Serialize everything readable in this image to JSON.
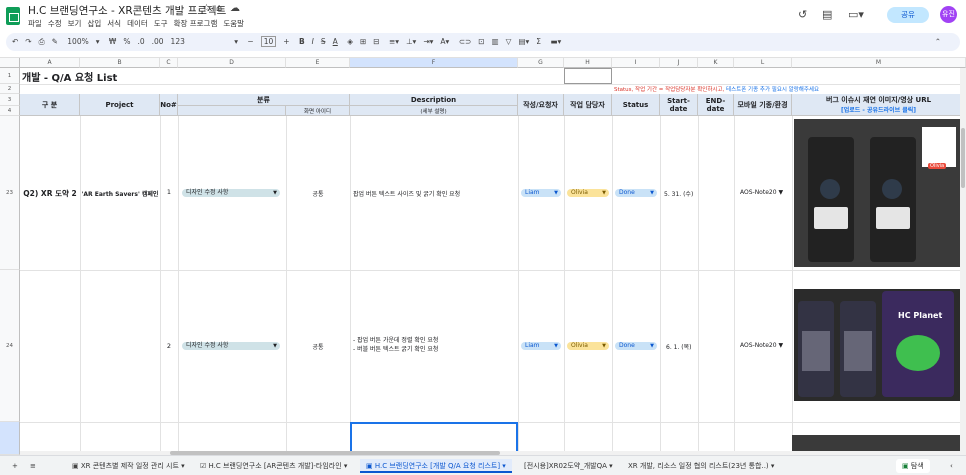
{
  "doc": {
    "title": "H.C 브랜딩연구소 - XR콘텐츠 개발 프로젝트",
    "user_initial": "유진",
    "share_label": "공유"
  },
  "menu": [
    "파일",
    "수정",
    "보기",
    "삽입",
    "서식",
    "데이터",
    "도구",
    "확장 프로그램",
    "도움말"
  ],
  "toolbar": {
    "zoom": "100%",
    "currency": "₩",
    "percent": "%",
    "dec_less": ".0",
    "dec_more": ".00",
    "number_format": "123",
    "font_size": "10"
  },
  "columns": [
    "A",
    "B",
    "C",
    "D",
    "E",
    "F",
    "G",
    "H",
    "I",
    "J",
    "K",
    "L",
    "M"
  ],
  "rows": {
    "r1": "1",
    "r2": "2",
    "r3": "3",
    "r4": "4",
    "r23": "23",
    "r24": "24"
  },
  "sheet": {
    "title": "개발 - Q/A 요청 List",
    "notice_red": "Status, 작업 기간 = 작업담당자분 확인하시고,",
    "notice_blue": "테스트폰 기종 추가 필요시 알랑해주세요",
    "headers": {
      "group": "구 분",
      "project": "Project",
      "no": "No#",
      "category": "분류",
      "screen_id": "화면 아이디",
      "desc": "Description",
      "desc_sub": "(세부 설명)",
      "writer": "작성/요청자",
      "assignee": "작업 담당자",
      "status": "Status",
      "start": "Start-date",
      "end": "END-date",
      "device": "모바일 기종/환경",
      "bug_url": "버그 이슈시 재연 이미지/영상 URL",
      "bug_url_sub": "[업로드 - 공유드라이브 클릭]"
    },
    "items": [
      {
        "group": "Q2) XR 도약 2",
        "project": "'AR Earth Savers' 캠페인",
        "no": "1",
        "category": "디자인 수정 사항",
        "screen_id": "공통",
        "desc": "팝업 버튼 텍스트 사이즈 및 굵기 확인 요청",
        "writer": "Liam",
        "assignee": "Olivia",
        "status": "Done",
        "start": "5. 31. (수)",
        "end": "",
        "device": "AOS-Note20"
      },
      {
        "group": "",
        "project": "",
        "no": "2",
        "category": "디자인 수정 사항",
        "screen_id": "공통",
        "desc": "- 팝업 버튼 가운데 정렬 확인 요청\n- 버블 버튼 텍스트 굵기 확인 요청",
        "writer": "Liam",
        "assignee": "Olivia",
        "status": "Done",
        "start": "6. 1. (목)",
        "end": "",
        "device": "AOS-Note20"
      }
    ],
    "screenshot_texts": {
      "planet": "HC Planet",
      "olivia": "Olivia"
    }
  },
  "tabs": [
    {
      "label": "XR 콘텐츠별 제작 일정 관리 시트"
    },
    {
      "label": "H.C 브랜딩연구소 [AR콘텐츠 개발]-타임라인"
    },
    {
      "label": "H.C 브랜딩연구소 [개발 Q/A 요청 리스트]"
    },
    {
      "label": "[전시용]XR02도약_개발QA"
    },
    {
      "label": "XR 개발, 리소스 일정 협의 리스트(23년 통합..)"
    }
  ],
  "explore": "탐색",
  "colors": {
    "writer_chip": "#c9e2f7",
    "assignee_chip": "#fbe39a",
    "status_chip": "#c9e2f7",
    "category_chip": "#cfe2e7",
    "header_bg": "#dfe8f4",
    "accent": "#0b57d0"
  }
}
